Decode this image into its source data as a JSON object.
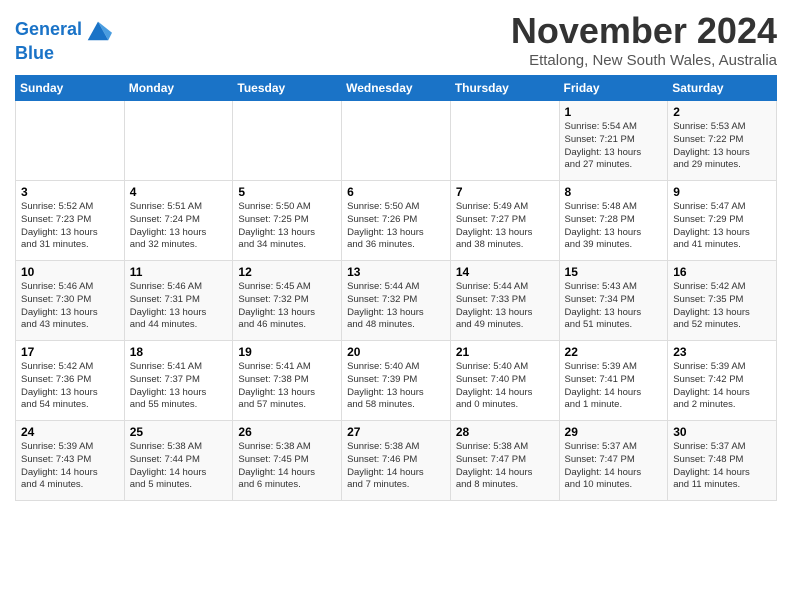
{
  "logo": {
    "line1": "General",
    "line2": "Blue"
  },
  "title": "November 2024",
  "location": "Ettalong, New South Wales, Australia",
  "days_of_week": [
    "Sunday",
    "Monday",
    "Tuesday",
    "Wednesday",
    "Thursday",
    "Friday",
    "Saturday"
  ],
  "weeks": [
    [
      {
        "day": "",
        "info": ""
      },
      {
        "day": "",
        "info": ""
      },
      {
        "day": "",
        "info": ""
      },
      {
        "day": "",
        "info": ""
      },
      {
        "day": "",
        "info": ""
      },
      {
        "day": "1",
        "info": "Sunrise: 5:54 AM\nSunset: 7:21 PM\nDaylight: 13 hours\nand 27 minutes."
      },
      {
        "day": "2",
        "info": "Sunrise: 5:53 AM\nSunset: 7:22 PM\nDaylight: 13 hours\nand 29 minutes."
      }
    ],
    [
      {
        "day": "3",
        "info": "Sunrise: 5:52 AM\nSunset: 7:23 PM\nDaylight: 13 hours\nand 31 minutes."
      },
      {
        "day": "4",
        "info": "Sunrise: 5:51 AM\nSunset: 7:24 PM\nDaylight: 13 hours\nand 32 minutes."
      },
      {
        "day": "5",
        "info": "Sunrise: 5:50 AM\nSunset: 7:25 PM\nDaylight: 13 hours\nand 34 minutes."
      },
      {
        "day": "6",
        "info": "Sunrise: 5:50 AM\nSunset: 7:26 PM\nDaylight: 13 hours\nand 36 minutes."
      },
      {
        "day": "7",
        "info": "Sunrise: 5:49 AM\nSunset: 7:27 PM\nDaylight: 13 hours\nand 38 minutes."
      },
      {
        "day": "8",
        "info": "Sunrise: 5:48 AM\nSunset: 7:28 PM\nDaylight: 13 hours\nand 39 minutes."
      },
      {
        "day": "9",
        "info": "Sunrise: 5:47 AM\nSunset: 7:29 PM\nDaylight: 13 hours\nand 41 minutes."
      }
    ],
    [
      {
        "day": "10",
        "info": "Sunrise: 5:46 AM\nSunset: 7:30 PM\nDaylight: 13 hours\nand 43 minutes."
      },
      {
        "day": "11",
        "info": "Sunrise: 5:46 AM\nSunset: 7:31 PM\nDaylight: 13 hours\nand 44 minutes."
      },
      {
        "day": "12",
        "info": "Sunrise: 5:45 AM\nSunset: 7:32 PM\nDaylight: 13 hours\nand 46 minutes."
      },
      {
        "day": "13",
        "info": "Sunrise: 5:44 AM\nSunset: 7:32 PM\nDaylight: 13 hours\nand 48 minutes."
      },
      {
        "day": "14",
        "info": "Sunrise: 5:44 AM\nSunset: 7:33 PM\nDaylight: 13 hours\nand 49 minutes."
      },
      {
        "day": "15",
        "info": "Sunrise: 5:43 AM\nSunset: 7:34 PM\nDaylight: 13 hours\nand 51 minutes."
      },
      {
        "day": "16",
        "info": "Sunrise: 5:42 AM\nSunset: 7:35 PM\nDaylight: 13 hours\nand 52 minutes."
      }
    ],
    [
      {
        "day": "17",
        "info": "Sunrise: 5:42 AM\nSunset: 7:36 PM\nDaylight: 13 hours\nand 54 minutes."
      },
      {
        "day": "18",
        "info": "Sunrise: 5:41 AM\nSunset: 7:37 PM\nDaylight: 13 hours\nand 55 minutes."
      },
      {
        "day": "19",
        "info": "Sunrise: 5:41 AM\nSunset: 7:38 PM\nDaylight: 13 hours\nand 57 minutes."
      },
      {
        "day": "20",
        "info": "Sunrise: 5:40 AM\nSunset: 7:39 PM\nDaylight: 13 hours\nand 58 minutes."
      },
      {
        "day": "21",
        "info": "Sunrise: 5:40 AM\nSunset: 7:40 PM\nDaylight: 14 hours\nand 0 minutes."
      },
      {
        "day": "22",
        "info": "Sunrise: 5:39 AM\nSunset: 7:41 PM\nDaylight: 14 hours\nand 1 minute."
      },
      {
        "day": "23",
        "info": "Sunrise: 5:39 AM\nSunset: 7:42 PM\nDaylight: 14 hours\nand 2 minutes."
      }
    ],
    [
      {
        "day": "24",
        "info": "Sunrise: 5:39 AM\nSunset: 7:43 PM\nDaylight: 14 hours\nand 4 minutes."
      },
      {
        "day": "25",
        "info": "Sunrise: 5:38 AM\nSunset: 7:44 PM\nDaylight: 14 hours\nand 5 minutes."
      },
      {
        "day": "26",
        "info": "Sunrise: 5:38 AM\nSunset: 7:45 PM\nDaylight: 14 hours\nand 6 minutes."
      },
      {
        "day": "27",
        "info": "Sunrise: 5:38 AM\nSunset: 7:46 PM\nDaylight: 14 hours\nand 7 minutes."
      },
      {
        "day": "28",
        "info": "Sunrise: 5:38 AM\nSunset: 7:47 PM\nDaylight: 14 hours\nand 8 minutes."
      },
      {
        "day": "29",
        "info": "Sunrise: 5:37 AM\nSunset: 7:47 PM\nDaylight: 14 hours\nand 10 minutes."
      },
      {
        "day": "30",
        "info": "Sunrise: 5:37 AM\nSunset: 7:48 PM\nDaylight: 14 hours\nand 11 minutes."
      }
    ]
  ]
}
